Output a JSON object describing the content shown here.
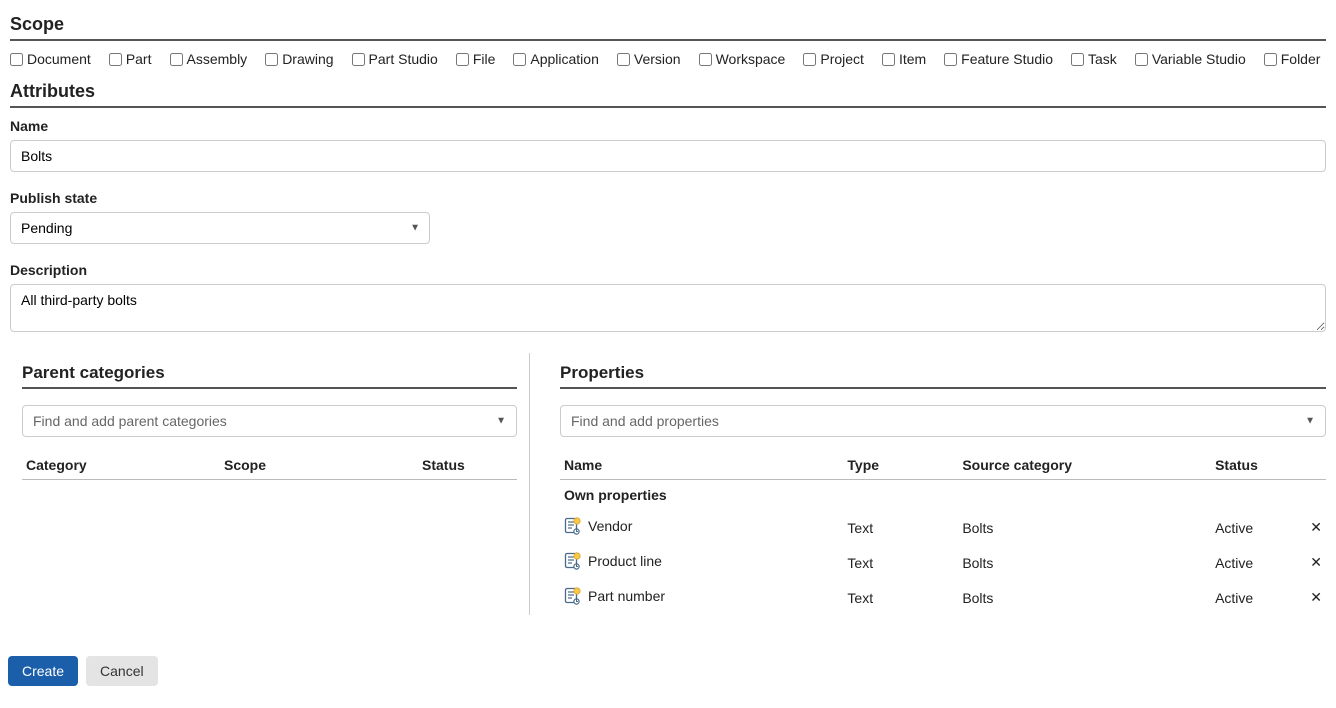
{
  "scope": {
    "header": "Scope",
    "items": [
      {
        "label": "Document"
      },
      {
        "label": "Part"
      },
      {
        "label": "Assembly"
      },
      {
        "label": "Drawing"
      },
      {
        "label": "Part Studio"
      },
      {
        "label": "File"
      },
      {
        "label": "Application"
      },
      {
        "label": "Version"
      },
      {
        "label": "Workspace"
      },
      {
        "label": "Project"
      },
      {
        "label": "Item"
      },
      {
        "label": "Feature Studio"
      },
      {
        "label": "Task"
      },
      {
        "label": "Variable Studio"
      },
      {
        "label": "Folder"
      }
    ]
  },
  "attributes": {
    "header": "Attributes",
    "name_label": "Name",
    "name_value": "Bolts",
    "publish_label": "Publish state",
    "publish_value": "Pending",
    "description_label": "Description",
    "description_value": "All third-party bolts"
  },
  "parent_categories": {
    "header": "Parent categories",
    "search_placeholder": "Find and add parent categories",
    "columns": {
      "category": "Category",
      "scope": "Scope",
      "status": "Status"
    }
  },
  "properties": {
    "header": "Properties",
    "search_placeholder": "Find and add properties",
    "columns": {
      "name": "Name",
      "type": "Type",
      "source": "Source category",
      "status": "Status"
    },
    "own_label": "Own properties",
    "rows": [
      {
        "name": "Vendor",
        "type": "Text",
        "source": "Bolts",
        "status": "Active"
      },
      {
        "name": "Product line",
        "type": "Text",
        "source": "Bolts",
        "status": "Active"
      },
      {
        "name": "Part number",
        "type": "Text",
        "source": "Bolts",
        "status": "Active"
      }
    ]
  },
  "footer": {
    "create_label": "Create",
    "cancel_label": "Cancel"
  }
}
